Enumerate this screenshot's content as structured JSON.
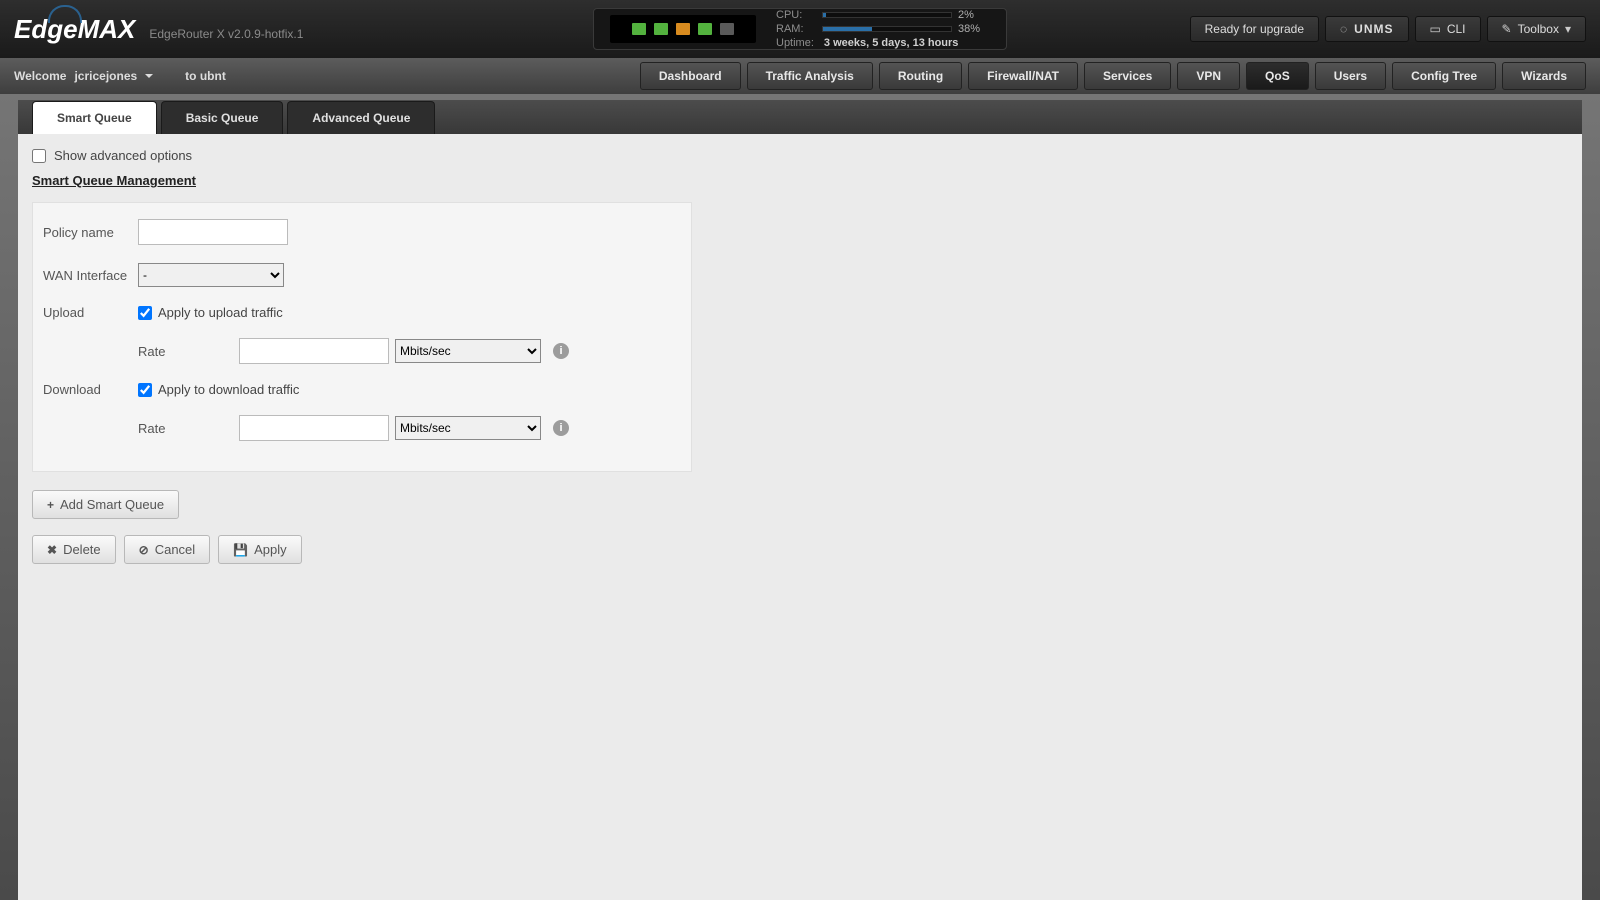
{
  "brand": {
    "logo_text": "EdgeMAX",
    "subtitle": "EdgeRouter X v2.0.9-hotfix.1"
  },
  "leds": [
    "green",
    "green",
    "orange",
    "green",
    "off"
  ],
  "sys": {
    "cpu_label": "CPU:",
    "cpu_pct": 2,
    "cpu_text": "2%",
    "ram_label": "RAM:",
    "ram_pct": 38,
    "ram_text": "38%",
    "uptime_label": "Uptime:",
    "uptime_value": "3 weeks, 5 days, 13 hours"
  },
  "topright": {
    "upgrade": "Ready for upgrade",
    "unms": "UNMS",
    "cli": "CLI",
    "toolbox": "Toolbox"
  },
  "welcome": {
    "prefix": "Welcome",
    "user": "jcricejones",
    "to_ubnt": "to ubnt"
  },
  "main_tabs": [
    "Dashboard",
    "Traffic Analysis",
    "Routing",
    "Firewall/NAT",
    "Services",
    "VPN",
    "QoS",
    "Users",
    "Config Tree",
    "Wizards"
  ],
  "main_tab_active": "QoS",
  "sub_tabs": [
    "Smart Queue",
    "Basic Queue",
    "Advanced Queue"
  ],
  "sub_tab_active": "Smart Queue",
  "advanced_opts": {
    "label": "Show advanced options",
    "checked": false
  },
  "section_title": "Smart Queue Management",
  "form": {
    "policy_label": "Policy name",
    "policy_value": "",
    "wan_label": "WAN Interface",
    "wan_selected": "-",
    "upload_label": "Upload",
    "upload_apply_label": "Apply to upload traffic",
    "upload_apply_checked": true,
    "rate_label": "Rate",
    "upload_rate_value": "",
    "upload_rate_unit": "Mbits/sec",
    "download_label": "Download",
    "download_apply_label": "Apply to download traffic",
    "download_apply_checked": true,
    "download_rate_value": "",
    "download_rate_unit": "Mbits/sec"
  },
  "buttons": {
    "add": "Add Smart Queue",
    "delete": "Delete",
    "cancel": "Cancel",
    "apply": "Apply"
  }
}
